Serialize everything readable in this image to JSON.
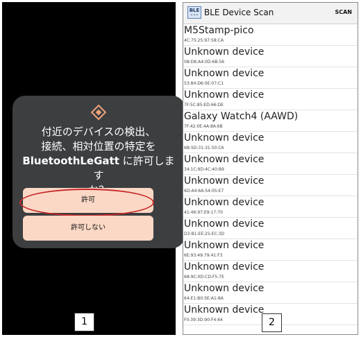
{
  "dialog": {
    "line1": "付近のデバイスの検出、",
    "line2": "接続、相対位置の特定を",
    "app_name": "BluetoothLeGatt",
    "line3_rest": " に許可しま",
    "line3_tail": "す",
    "line4": "か？",
    "allow_label": "許可",
    "deny_label": "許可しない"
  },
  "labels": {
    "panel1": "1",
    "panel2": "2"
  },
  "app": {
    "icon_text": "BLE",
    "title": "BLE Device Scan",
    "action": "SCAN"
  },
  "devices": [
    {
      "name": "M5Stamp-pico",
      "address": "4C:75:25:97:58:CA"
    },
    {
      "name": "Unknown device",
      "address": "08:D8:A4:0D:6B:56"
    },
    {
      "name": "Unknown device",
      "address": "53:84:D6:0E:07:C1"
    },
    {
      "name": "Unknown device",
      "address": "7F:5C:85:ED:66:DE"
    },
    {
      "name": "Galaxy Watch4 (AAWD)",
      "address": "7F:42:0E:4A:8A:6B"
    },
    {
      "name": "Unknown device",
      "address": "6B:5D:31:31:50:C6"
    },
    {
      "name": "Unknown device",
      "address": "34:1C:9D:4C:40:B9"
    },
    {
      "name": "Unknown device",
      "address": "6D:A4:6A:54:05:E7"
    },
    {
      "name": "Unknown device",
      "address": "41:46:97:E9:17:70"
    },
    {
      "name": "Unknown device",
      "address": "D3:B1:EE:25:EC:3D"
    },
    {
      "name": "Unknown device",
      "address": "6E:93:49:79:41:F3"
    },
    {
      "name": "Unknown device",
      "address": "68:9C:0D:CD:F5:7E"
    },
    {
      "name": "Unknown device",
      "address": "64:E1:B0:5E:A1:8A"
    },
    {
      "name": "Unknown device",
      "address": "F0:39:3D:90:F4:64"
    }
  ],
  "colors": {
    "dialog_bg": "#3c3e40",
    "button_bg": "#fbd8c5",
    "accent": "#f0a37a",
    "highlight_ellipse": "#c62828"
  }
}
